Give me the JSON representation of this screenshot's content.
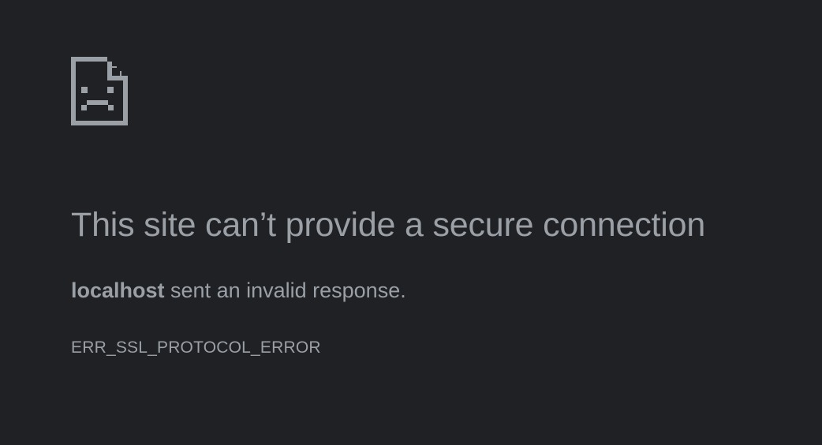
{
  "icon": "sad-page-icon",
  "colors": {
    "background": "#202124",
    "text": "#9aa0a6"
  },
  "error": {
    "title": "This site can’t provide a secure connection",
    "host": "localhost",
    "description": " sent an invalid response.",
    "code": "ERR_SSL_PROTOCOL_ERROR"
  }
}
